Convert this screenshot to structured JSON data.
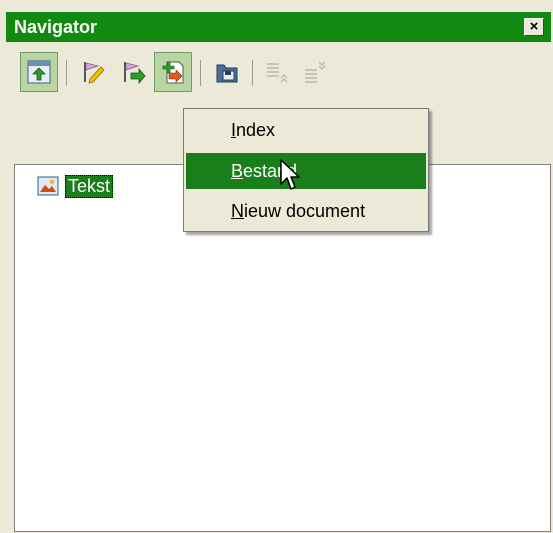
{
  "window": {
    "title": "Navigator",
    "close_glyph": "×"
  },
  "toolbar": {
    "buttons": [
      {
        "icon": "navigator-toggle-icon"
      },
      {
        "icon": "edit-pencil-icon"
      },
      {
        "icon": "flag-arrow-icon"
      },
      {
        "icon": "insert-doc-icon"
      },
      {
        "icon": "save-folder-icon"
      },
      {
        "icon": "promote-level-icon"
      },
      {
        "icon": "demote-level-icon"
      }
    ]
  },
  "tree": {
    "item_label": "Tekst"
  },
  "menu": {
    "items": [
      {
        "prefix": "I",
        "rest": "ndex",
        "selected": false
      },
      {
        "prefix": "B",
        "rest": "estand",
        "selected": true
      },
      {
        "prefix": "N",
        "rest": "ieuw document",
        "selected": false
      }
    ]
  },
  "colors": {
    "accent": "#1a7e1a",
    "title_bg": "#128a12",
    "face": "#ece9d8"
  }
}
